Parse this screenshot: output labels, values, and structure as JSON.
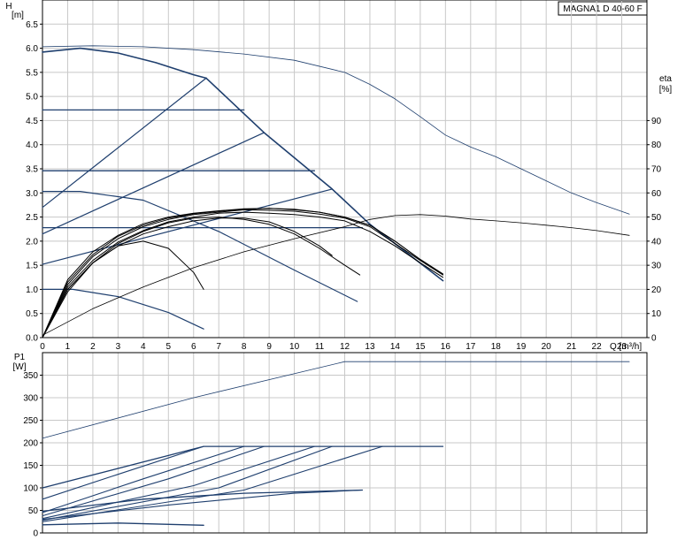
{
  "chart_data": [
    {
      "type": "line",
      "id": "qh",
      "title": "MAGNA1 D 40-60 F",
      "ylabel": "H",
      "ylabel_unit": "[m]",
      "y2label": "eta",
      "y2label_unit": "[%]",
      "xlabel": "Q [m³/h]",
      "xlim": [
        0,
        24
      ],
      "ylim": [
        0,
        7.0
      ],
      "y2lim": [
        0,
        100
      ],
      "xticks": [
        0,
        1,
        2,
        3,
        4,
        5,
        6,
        7,
        8,
        9,
        10,
        11,
        12,
        13,
        14,
        15,
        16,
        17,
        18,
        19,
        20,
        21,
        22,
        23
      ],
      "yticks": [
        0.0,
        0.5,
        1.0,
        1.5,
        2.0,
        2.5,
        3.0,
        3.5,
        4.0,
        4.5,
        5.0,
        5.5,
        6.0,
        6.5
      ],
      "ytick_labels": [
        "0.0",
        "0.5",
        "1.0",
        "1.5",
        "2.0",
        "2.5",
        "3.0",
        "3.5",
        "4.0",
        "4.5",
        "5.0",
        "5.5",
        "6.0",
        "6.5"
      ],
      "y2ticks": [
        0,
        10,
        20,
        30,
        40,
        50,
        60,
        70,
        80,
        90
      ],
      "grid": true,
      "series": [
        {
          "color": "#1f3f6e",
          "width": 1.6,
          "x": [
            0,
            1.5,
            3,
            4.5,
            6,
            6.5
          ],
          "y": [
            5.92,
            6.0,
            5.9,
            5.7,
            5.45,
            5.38
          ]
        },
        {
          "color": "#1f3f6e",
          "width": 1.6,
          "x": [
            6.5,
            8.8,
            11.5,
            13,
            15.9
          ],
          "y": [
            5.38,
            4.25,
            3.08,
            2.35,
            1.18
          ]
        },
        {
          "color": "#1f3f6e",
          "width": 1.3,
          "x": [
            0,
            8
          ],
          "y": [
            4.72,
            4.72
          ]
        },
        {
          "color": "#1f3f6e",
          "width": 1.3,
          "x": [
            0,
            10.8
          ],
          "y": [
            3.46,
            3.46
          ]
        },
        {
          "color": "#1f3f6e",
          "width": 1.3,
          "x": [
            0,
            12.7
          ],
          "y": [
            2.28,
            2.28
          ]
        },
        {
          "color": "#1f3f6e",
          "width": 1.2,
          "x": [
            0,
            6.5
          ],
          "y": [
            2.7,
            5.38
          ]
        },
        {
          "color": "#1f3f6e",
          "width": 1.2,
          "x": [
            0,
            8.8
          ],
          "y": [
            2.15,
            4.25
          ]
        },
        {
          "color": "#1f3f6e",
          "width": 1.2,
          "x": [
            0,
            11.5
          ],
          "y": [
            1.52,
            3.08
          ]
        },
        {
          "color": "#1f3f6e",
          "width": 1.2,
          "x": [
            0,
            1.5,
            4,
            7,
            10,
            12.5
          ],
          "y": [
            3.03,
            3.03,
            2.85,
            2.2,
            1.4,
            0.75
          ]
        },
        {
          "color": "#1f3f6e",
          "width": 1.2,
          "x": [
            0,
            1.2,
            3,
            5,
            6.4
          ],
          "y": [
            1.0,
            1.0,
            0.85,
            0.52,
            0.18
          ]
        },
        {
          "color": "#000000",
          "width": 1.0,
          "x": [
            0,
            1,
            2,
            3,
            4,
            5,
            6,
            6.4
          ],
          "y": [
            0,
            0.95,
            1.55,
            1.9,
            2.0,
            1.85,
            1.35,
            1.0
          ]
        },
        {
          "color": "#000000",
          "width": 1.0,
          "x": [
            0,
            1,
            2,
            3,
            4,
            5,
            6,
            7,
            8,
            9,
            10,
            11,
            12,
            12.6
          ],
          "y": [
            0,
            1.0,
            1.55,
            1.95,
            2.2,
            2.38,
            2.48,
            2.5,
            2.45,
            2.35,
            2.15,
            1.85,
            1.5,
            1.3
          ]
        },
        {
          "color": "#000000",
          "width": 1.0,
          "x": [
            0,
            1,
            2,
            3,
            4,
            5,
            6,
            7,
            8,
            9,
            10,
            11,
            11.5
          ],
          "y": [
            0,
            1.0,
            1.55,
            1.9,
            2.15,
            2.3,
            2.42,
            2.48,
            2.48,
            2.4,
            2.2,
            1.9,
            1.7
          ]
        },
        {
          "color": "#000000",
          "width": 1.0,
          "x": [
            0,
            1,
            2,
            3,
            4,
            5,
            6,
            7,
            8,
            9,
            10,
            11,
            12,
            13,
            14,
            15,
            15.9
          ],
          "y": [
            0,
            1.05,
            1.6,
            1.98,
            2.22,
            2.4,
            2.5,
            2.58,
            2.6,
            2.58,
            2.55,
            2.5,
            2.42,
            2.2,
            1.9,
            1.55,
            1.25
          ]
        },
        {
          "color": "#000000",
          "width": 1.0,
          "x": [
            0,
            1,
            2,
            3,
            4,
            5,
            6,
            7,
            8,
            9,
            10,
            11,
            12,
            13,
            14,
            15,
            15.9
          ],
          "y": [
            0,
            1.1,
            1.68,
            2.05,
            2.3,
            2.45,
            2.55,
            2.6,
            2.65,
            2.64,
            2.62,
            2.56,
            2.48,
            2.3,
            1.95,
            1.6,
            1.3
          ]
        },
        {
          "color": "#000000",
          "width": 1.0,
          "x": [
            0,
            1,
            2,
            3,
            4,
            5,
            6,
            7,
            8,
            9,
            10,
            11,
            12,
            13,
            14,
            15,
            15.9
          ],
          "y": [
            0,
            1.15,
            1.72,
            2.1,
            2.33,
            2.48,
            2.57,
            2.62,
            2.66,
            2.68,
            2.65,
            2.6,
            2.5,
            2.33,
            2.0,
            1.62,
            1.32
          ]
        },
        {
          "color": "#000000",
          "width": 1.0,
          "x": [
            0,
            1,
            2,
            3,
            4,
            5,
            6,
            7,
            8,
            9,
            10,
            11,
            12,
            13,
            14,
            15,
            15.9
          ],
          "y": [
            0,
            1.2,
            1.78,
            2.12,
            2.36,
            2.5,
            2.58,
            2.63,
            2.67,
            2.68,
            2.66,
            2.6,
            2.5,
            2.33,
            2.0,
            1.62,
            1.32
          ]
        },
        {
          "color": "#1f3f6e",
          "width": 0.8,
          "x": [
            0,
            2,
            4,
            6,
            8,
            10,
            12,
            13,
            14,
            15,
            16,
            17,
            18,
            19,
            20,
            21,
            22,
            23.3
          ],
          "y": [
            6.03,
            6.05,
            6.03,
            5.97,
            5.88,
            5.75,
            5.5,
            5.25,
            4.95,
            4.58,
            4.2,
            3.95,
            3.75,
            3.5,
            3.25,
            3.0,
            2.8,
            2.56
          ]
        },
        {
          "color": "#000000",
          "width": 0.8,
          "x": [
            0,
            2,
            4,
            6,
            8,
            10,
            12,
            13,
            14,
            15,
            16,
            17,
            18,
            19,
            20,
            21,
            22,
            23.3
          ],
          "y": [
            0.05,
            0.6,
            1.05,
            1.45,
            1.78,
            2.05,
            2.3,
            2.45,
            2.53,
            2.55,
            2.52,
            2.46,
            2.42,
            2.38,
            2.33,
            2.28,
            2.22,
            2.12
          ]
        }
      ]
    },
    {
      "type": "line",
      "id": "p1",
      "ylabel": "P1",
      "ylabel_unit": "[W]",
      "xlim": [
        0,
        24
      ],
      "ylim": [
        0,
        400
      ],
      "yticks": [
        0,
        50,
        100,
        150,
        200,
        250,
        300,
        350
      ],
      "grid": true,
      "series": [
        {
          "color": "#1f3f6e",
          "width": 0.8,
          "x": [
            0,
            6,
            12,
            18,
            23.3
          ],
          "y": [
            210,
            300,
            380,
            380,
            380
          ]
        },
        {
          "color": "#1f3f6e",
          "width": 1.3,
          "x": [
            0,
            6.4,
            15.9
          ],
          "y": [
            100,
            192,
            192
          ]
        },
        {
          "color": "#1f3f6e",
          "width": 1.3,
          "x": [
            0,
            4,
            8,
            12.7
          ],
          "y": [
            48,
            75,
            88,
            95
          ]
        },
        {
          "color": "#1f3f6e",
          "width": 1.3,
          "x": [
            0,
            3,
            6.4
          ],
          "y": [
            18,
            22,
            17
          ]
        },
        {
          "color": "#1f3f6e",
          "width": 1.1,
          "x": [
            0,
            3,
            6.4
          ],
          "y": [
            75,
            130,
            192
          ]
        },
        {
          "color": "#1f3f6e",
          "width": 1.1,
          "x": [
            0,
            4,
            8
          ],
          "y": [
            45,
            120,
            192
          ]
        },
        {
          "color": "#1f3f6e",
          "width": 1.1,
          "x": [
            0,
            5,
            8.8
          ],
          "y": [
            38,
            120,
            192
          ]
        },
        {
          "color": "#1f3f6e",
          "width": 1.1,
          "x": [
            0,
            6,
            10.8
          ],
          "y": [
            32,
            105,
            192
          ]
        },
        {
          "color": "#1f3f6e",
          "width": 1.1,
          "x": [
            0,
            7,
            11.5
          ],
          "y": [
            28,
            100,
            192
          ]
        },
        {
          "color": "#1f3f6e",
          "width": 1.1,
          "x": [
            0,
            8,
            13.5
          ],
          "y": [
            25,
            95,
            192
          ]
        },
        {
          "color": "#1f3f6e",
          "width": 1.1,
          "x": [
            0,
            5,
            10,
            12.7
          ],
          "y": [
            30,
            62,
            88,
            95
          ]
        }
      ]
    }
  ]
}
